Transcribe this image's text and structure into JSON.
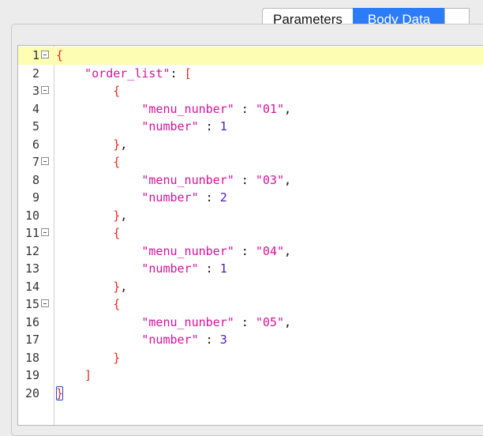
{
  "tabs": [
    {
      "label": "Parameters",
      "active": false
    },
    {
      "label": "Body Data",
      "active": true
    }
  ],
  "editor": {
    "highlighted_line": 1,
    "lines": [
      {
        "n": "1",
        "fold": true,
        "tokens": [
          [
            "{",
            "brace"
          ]
        ]
      },
      {
        "n": "2",
        "fold": false,
        "tokens": [
          [
            "    \"order_list\"",
            "key"
          ],
          [
            ": ",
            "punct"
          ],
          [
            "[",
            "brace"
          ]
        ]
      },
      {
        "n": "3",
        "fold": true,
        "tokens": [
          [
            "        {",
            "brace"
          ]
        ]
      },
      {
        "n": "4",
        "fold": false,
        "tokens": [
          [
            "            \"menu_nunber\"",
            "key"
          ],
          [
            " : ",
            "punct"
          ],
          [
            "\"01\"",
            "str"
          ],
          [
            ",",
            "punct"
          ]
        ]
      },
      {
        "n": "5",
        "fold": false,
        "tokens": [
          [
            "            \"number\"",
            "key"
          ],
          [
            " : ",
            "punct"
          ],
          [
            "1",
            "num"
          ]
        ]
      },
      {
        "n": "6",
        "fold": false,
        "tokens": [
          [
            "        }",
            "brace"
          ],
          [
            ",",
            "punct"
          ]
        ]
      },
      {
        "n": "7",
        "fold": true,
        "tokens": [
          [
            "        {",
            "brace"
          ]
        ]
      },
      {
        "n": "8",
        "fold": false,
        "tokens": [
          [
            "            \"menu_nunber\"",
            "key"
          ],
          [
            " : ",
            "punct"
          ],
          [
            "\"03\"",
            "str"
          ],
          [
            ",",
            "punct"
          ]
        ]
      },
      {
        "n": "9",
        "fold": false,
        "tokens": [
          [
            "            \"number\"",
            "key"
          ],
          [
            " : ",
            "punct"
          ],
          [
            "2",
            "num"
          ]
        ]
      },
      {
        "n": "10",
        "fold": false,
        "tokens": [
          [
            "        }",
            "brace"
          ],
          [
            ",",
            "punct"
          ]
        ]
      },
      {
        "n": "11",
        "fold": true,
        "tokens": [
          [
            "        {",
            "brace"
          ]
        ]
      },
      {
        "n": "12",
        "fold": false,
        "tokens": [
          [
            "            \"menu_nunber\"",
            "key"
          ],
          [
            " : ",
            "punct"
          ],
          [
            "\"04\"",
            "str"
          ],
          [
            ",",
            "punct"
          ]
        ]
      },
      {
        "n": "13",
        "fold": false,
        "tokens": [
          [
            "            \"number\"",
            "key"
          ],
          [
            " : ",
            "punct"
          ],
          [
            "1",
            "num"
          ]
        ]
      },
      {
        "n": "14",
        "fold": false,
        "tokens": [
          [
            "        }",
            "brace"
          ],
          [
            ",",
            "punct"
          ]
        ]
      },
      {
        "n": "15",
        "fold": true,
        "tokens": [
          [
            "        {",
            "brace"
          ]
        ]
      },
      {
        "n": "16",
        "fold": false,
        "tokens": [
          [
            "            \"menu_nunber\"",
            "key"
          ],
          [
            " : ",
            "punct"
          ],
          [
            "\"05\"",
            "str"
          ],
          [
            ",",
            "punct"
          ]
        ]
      },
      {
        "n": "17",
        "fold": false,
        "tokens": [
          [
            "            \"number\"",
            "key"
          ],
          [
            " : ",
            "punct"
          ],
          [
            "3",
            "num"
          ]
        ]
      },
      {
        "n": "18",
        "fold": false,
        "tokens": [
          [
            "        }",
            "brace"
          ]
        ]
      },
      {
        "n": "19",
        "fold": false,
        "tokens": [
          [
            "    ]",
            "brace"
          ]
        ]
      },
      {
        "n": "20",
        "fold": false,
        "tokens": [
          [
            "}",
            "brace-cursor"
          ]
        ]
      }
    ]
  },
  "colors": {
    "active_tab": "#2b7cf6",
    "brace": "#e8281c",
    "string_key": "#d6119c",
    "number": "#4b18c8",
    "line_highlight": "#fdfdb4"
  }
}
